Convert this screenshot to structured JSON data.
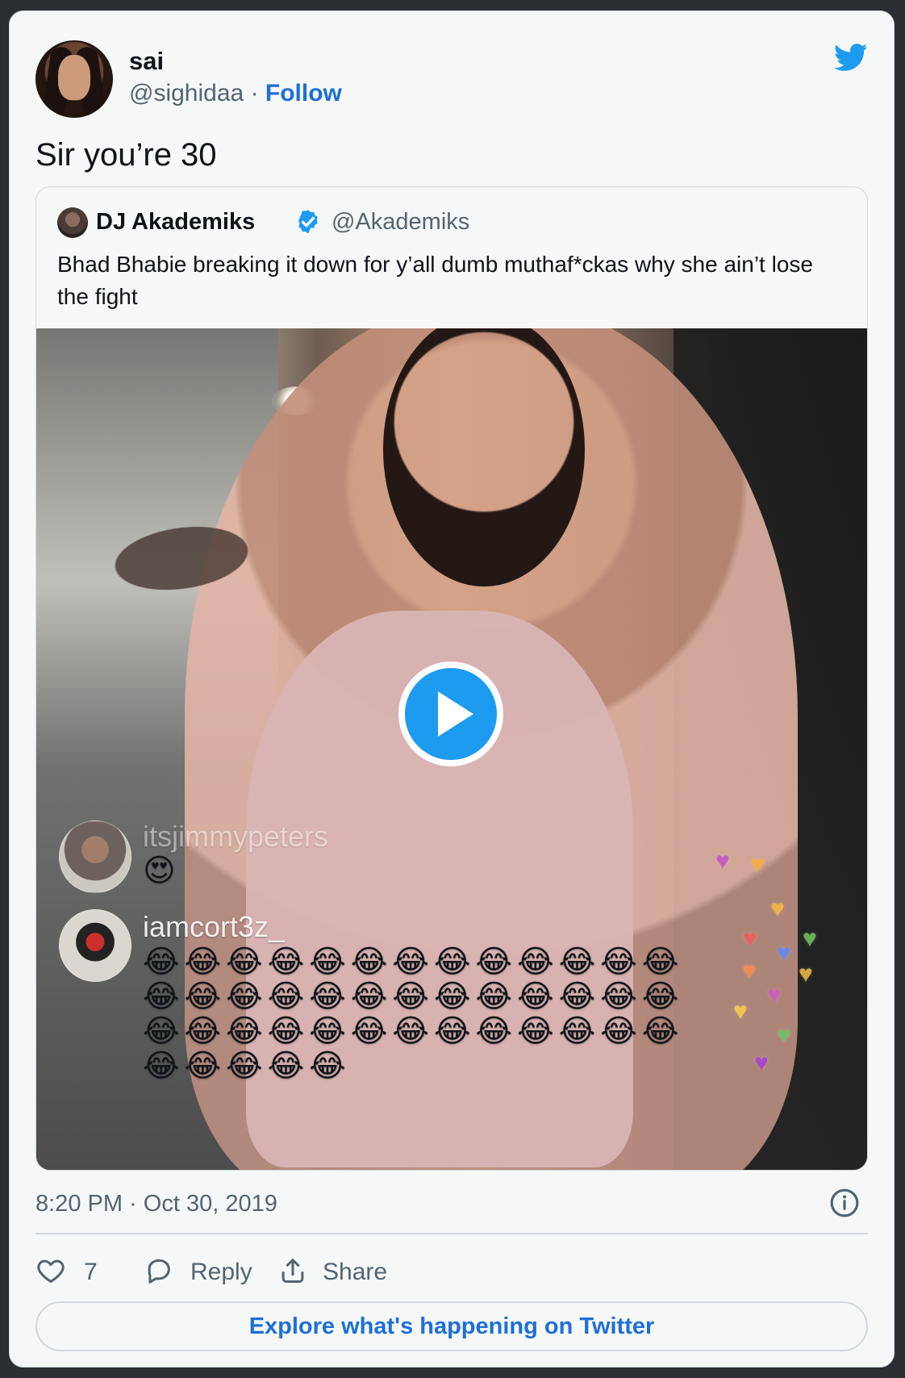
{
  "tweet": {
    "author_name": "sai",
    "handle": "@sighidaa",
    "separator": "·",
    "follow_label": "Follow",
    "text": "Sir you’re 30",
    "timestamp": "8:20 PM · Oct 30, 2019",
    "likes_count": "7",
    "reply_label": "Reply",
    "share_label": "Share",
    "explore_label": "Explore what's happening on Twitter",
    "brand_color": "#1d9bf0"
  },
  "quoted_tweet": {
    "author_name": "DJ Akademiks",
    "handle": "@Akademiks",
    "verified": true,
    "text": "Bhad Bhabie breaking it down for y’all dumb muthaf*ckas why she ain’t lose the fight"
  },
  "video": {
    "play_icon": "play-icon",
    "comments": [
      {
        "username": "itsjimmypeters",
        "emoji_line": "😍"
      },
      {
        "username": "iamcort3z_",
        "emoji_lines": [
          "😂😂😂😂😂😂😂😂😂😂😂😂😂",
          "😂😂😂😂😂😂😂😂😂😂😂😂😂",
          "😂😂😂😂😂😂😂😂😂😂😂😂😂",
          "😂😂😂😂😂"
        ]
      }
    ]
  },
  "icons": {
    "twitter": "twitter-icon",
    "verified": "verified-badge-icon",
    "info": "info-icon",
    "like": "heart-icon",
    "reply": "reply-icon",
    "share": "share-icon"
  }
}
